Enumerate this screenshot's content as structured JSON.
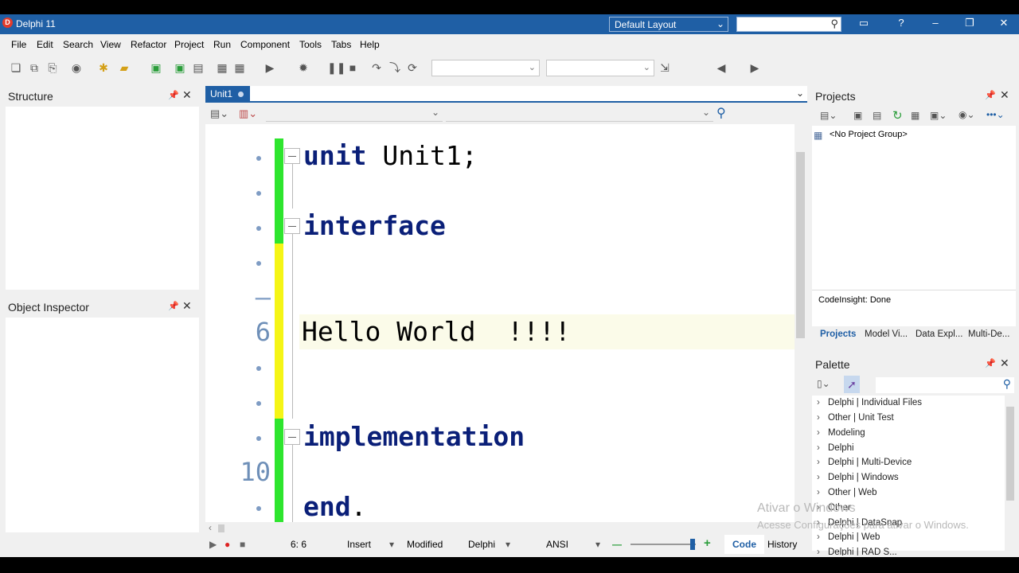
{
  "window": {
    "title": "Delphi 11",
    "layout_value": "Default Layout"
  },
  "menu": [
    "File",
    "Edit",
    "Search",
    "View",
    "Refactor",
    "Project",
    "Run",
    "Component",
    "Tools",
    "Tabs",
    "Help"
  ],
  "structure_panel": {
    "title": "Structure"
  },
  "object_inspector": {
    "title": "Object Inspector"
  },
  "editor": {
    "tab_label": "Unit1",
    "gutter": {
      "line5": "–",
      "line6": "6",
      "line10": "10"
    },
    "code": {
      "l1_kw": "unit",
      "l1_rest": " Unit1;",
      "l3_kw": "interface",
      "l6": "Hello World  !!!!",
      "l9_kw": "implementation",
      "l11_kw": "end",
      "l11_rest": "."
    }
  },
  "status": {
    "position": "6:  6",
    "mode": "Insert",
    "modified": "Modified",
    "language": "Delphi",
    "encoding": "ANSI",
    "tab_code": "Code",
    "tab_history": "History"
  },
  "projects_panel": {
    "title": "Projects",
    "item": "<No Project Group>",
    "codeinsight": "CodeInsight: Done",
    "tabs": [
      "Projects",
      "Model Vi...",
      "Data Expl...",
      "Multi-De..."
    ]
  },
  "palette_panel": {
    "title": "Palette",
    "items": [
      "Delphi | Individual Files",
      "Other | Unit Test",
      "Modeling",
      "Delphi",
      "Delphi | Multi-Device",
      "Delphi | Windows",
      "Other | Web",
      "Other",
      "Delphi | DataSnap",
      "Delphi | Web",
      "Delphi | RAD S..."
    ]
  },
  "watermark": {
    "line1": "Ativar o Windows",
    "line2": "Acesse Configurações para ativar o Windows."
  }
}
